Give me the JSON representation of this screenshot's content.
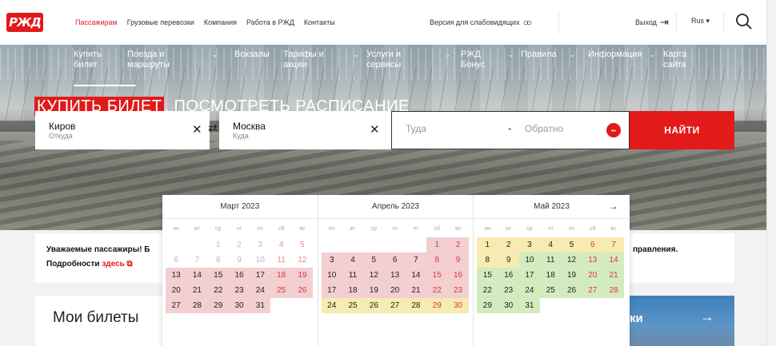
{
  "header": {
    "logo": "РЖД",
    "nav": [
      {
        "label": "Пассажирам",
        "active": true
      },
      {
        "label": "Грузовые перевозки"
      },
      {
        "label": "Компания"
      },
      {
        "label": "Работа в РЖД"
      },
      {
        "label": "Контакты"
      }
    ],
    "accessibility": "Версия для слабовидящих",
    "exit": "Выход",
    "lang": "Rus ▾"
  },
  "main_nav": [
    {
      "line1": "Купить",
      "line2": "билет",
      "chev": false
    },
    {
      "line1": "Поезда и",
      "line2": "маршруты",
      "chev": true
    },
    {
      "line1": "Вокзалы",
      "line2": "",
      "chev": false
    },
    {
      "line1": "Тарифы и",
      "line2": "акции",
      "chev": true
    },
    {
      "line1": "Услуги и",
      "line2": "сервисы",
      "chev": true
    },
    {
      "line1": "РЖД",
      "line2": "Бонус",
      "chev": true
    },
    {
      "line1": "Правила",
      "line2": "",
      "chev": true
    },
    {
      "line1": "Информация",
      "line2": "",
      "chev": true
    },
    {
      "line1": "Карта",
      "line2": "сайта",
      "chev": false
    }
  ],
  "headline": {
    "highlight": "КУПИТЬ БИЛЕТ",
    "rest": ", ПОСМОТРЕТЬ РАСПИСАНИЕ"
  },
  "search": {
    "from_value": "Киров",
    "from_label": "Откуда",
    "to_value": "Москва",
    "to_label": "Куда",
    "there_placeholder": "Туда",
    "back_placeholder": "Обратно",
    "dash": "-",
    "find_label": "НАЙТИ"
  },
  "notice": {
    "line1": "Уважаемые пассажиры! Б",
    "line2_prefix": "Подробности ",
    "line2_link": "здесь",
    "right_text": "правления."
  },
  "cards": {
    "my_tickets": "Мои билеты",
    "blue_text": "ки"
  },
  "calendar": {
    "weekdays": [
      "пн",
      "вт",
      "ср",
      "чт",
      "пт",
      "сб",
      "вс"
    ],
    "months": [
      {
        "title": "Март 2023",
        "offset": 2,
        "days": 31,
        "today": 13,
        "style": "pink"
      },
      {
        "title": "Апрель 2023",
        "offset": 5,
        "days": 30,
        "today": 0,
        "style": "mixed"
      },
      {
        "title": "Май 2023",
        "offset": 0,
        "days": 31,
        "today": 0,
        "style": "mixed"
      }
    ],
    "next_arrow": "→"
  },
  "colors": {
    "brand_red": "#e21a1a",
    "pink": "#f3cfd1",
    "yellow": "#f6ebb0",
    "green": "#d4ebc0"
  }
}
